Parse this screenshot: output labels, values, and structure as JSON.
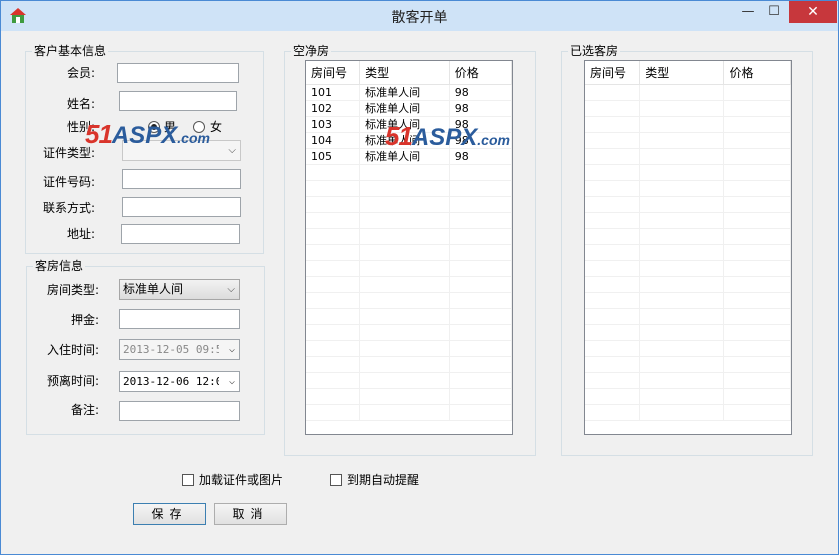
{
  "window": {
    "title": "散客开单",
    "minimize": "—",
    "maximize": "☐",
    "close": "✕"
  },
  "customer": {
    "group_label": "客户基本信息",
    "member_label": "会员:",
    "member_value": "",
    "name_label": "姓名:",
    "name_value": "",
    "gender_label": "性别:",
    "gender_male": "男",
    "gender_female": "女",
    "gender_selected": "男",
    "id_type_label": "证件类型:",
    "id_type_value": "",
    "id_number_label": "证件号码:",
    "id_number_value": "",
    "contact_label": "联系方式:",
    "contact_value": "",
    "address_label": "地址:",
    "address_value": ""
  },
  "room": {
    "group_label": "客房信息",
    "room_type_label": "房间类型:",
    "room_type_value": "标准单人间",
    "deposit_label": "押金:",
    "deposit_value": "",
    "checkin_label": "入住时间:",
    "checkin_value": "2013-12-05 09:5",
    "checkout_label": "预离时间:",
    "checkout_value": "2013-12-06 12:0",
    "note_label": "备注:",
    "note_value": ""
  },
  "vacant": {
    "group_label": "空净房",
    "columns": [
      "房间号",
      "类型",
      "价格"
    ],
    "rows": [
      [
        "101",
        "标准单人间",
        "98"
      ],
      [
        "102",
        "标准单人间",
        "98"
      ],
      [
        "103",
        "标准单人间",
        "98"
      ],
      [
        "104",
        "标准单人间",
        "98"
      ],
      [
        "105",
        "标准单人间",
        "98"
      ]
    ]
  },
  "selected": {
    "group_label": "已选客房",
    "columns": [
      "房间号",
      "类型",
      "价格"
    ],
    "rows": []
  },
  "options": {
    "load_id_label": "加载证件或图片",
    "auto_remind_label": "到期自动提醒"
  },
  "actions": {
    "save_label": "保存",
    "cancel_label": "取消"
  },
  "watermark": {
    "num": "51",
    "brand": "ASPX",
    "domain": ".com"
  },
  "colors": {
    "title_bar": "#cfe3f7",
    "close_button": "#c7373c",
    "background": "#f0f0f0"
  }
}
